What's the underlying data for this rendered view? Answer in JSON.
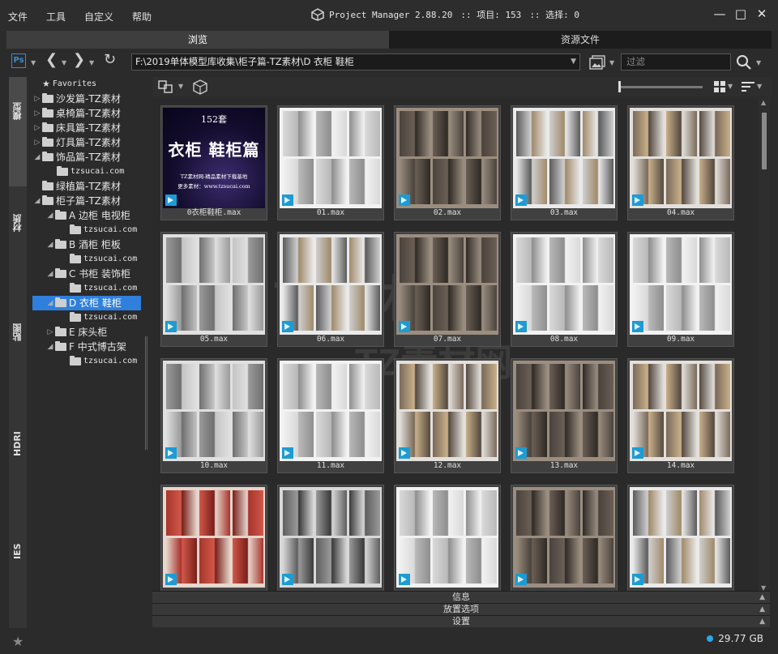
{
  "menu": {
    "file": "文件",
    "tools": "工具",
    "customize": "自定义",
    "help": "帮助"
  },
  "title": {
    "app": "Project Manager 2.88.20",
    "project": ":: 项目: 153",
    "selection": ":: 选择: 0"
  },
  "tabs": {
    "browse": "浏览",
    "assets": "资源文件"
  },
  "toolbar": {
    "path": "F:\\2019单体模型库收集\\柜子篇-TZ素材\\D 衣柜 鞋柜",
    "filter_placeholder": "过滤"
  },
  "rail": {
    "models": "模型",
    "materials": "材质",
    "maps": "贴图",
    "hdri": "HDRI",
    "ies": "IES"
  },
  "tree": {
    "favorites": "Favorites",
    "sofa": "沙发篇-TZ素材",
    "table_chair": "桌椅篇-TZ素材",
    "bed": "床具篇-TZ素材",
    "lamp": "灯具篇-TZ素材",
    "deco": "饰品篇-TZ素材",
    "deco_sub": "tzsucai.com",
    "plant": "绿植篇-TZ素材",
    "cabinet": "柜子篇-TZ素材",
    "a": "A 边柜 电视柜",
    "a_sub": "tzsucai.com",
    "b": "B 酒柜 柜板",
    "b_sub": "tzsucai.com",
    "c": "C 书柜 装饰柜",
    "c_sub": "tzsucai.com",
    "d": "D 衣柜 鞋柜",
    "d_sub": "tzsucai.com",
    "e": "E 床头柜",
    "f": "F 中式博古架",
    "f_sub": "tzsucai.com"
  },
  "cover": {
    "count": "152套",
    "title": "衣柜 鞋柜篇",
    "line1": "TZ素材网-精品素材下载基地",
    "line2": "更多素材：www.tzsucai.com"
  },
  "files": [
    {
      "name": "0衣柜鞋柜.max",
      "style": "cover"
    },
    {
      "name": "01.max",
      "style": "white"
    },
    {
      "name": "02.max",
      "style": "dark"
    },
    {
      "name": "03.max",
      "style": "mixed"
    },
    {
      "name": "04.max",
      "style": "wood"
    },
    {
      "name": "05.max",
      "style": "grey"
    },
    {
      "name": "06.max",
      "style": "mixed"
    },
    {
      "name": "07.max",
      "style": "dark"
    },
    {
      "name": "08.max",
      "style": "white"
    },
    {
      "name": "09.max",
      "style": "white"
    },
    {
      "name": "10.max",
      "style": "grey"
    },
    {
      "name": "11.max",
      "style": "white"
    },
    {
      "name": "12.max",
      "style": "wood"
    },
    {
      "name": "13.max",
      "style": "dark"
    },
    {
      "name": "14.max",
      "style": "wood"
    },
    {
      "name": "",
      "style": "red"
    },
    {
      "name": "",
      "style": "grid"
    },
    {
      "name": "",
      "style": "white"
    },
    {
      "name": "",
      "style": "dark"
    },
    {
      "name": "",
      "style": "mixed"
    }
  ],
  "panels": {
    "info": "信息",
    "placement": "放置选项",
    "settings": "设置"
  },
  "status": {
    "disk": "29.77 GB"
  },
  "watermark": {
    "brand": "TZ素材网",
    "domain": "TZSUCAI.COM"
  },
  "colors": {
    "accent": "#2f7fdc",
    "max_badge": "#1d9bd2",
    "ps": "#3a8bd6"
  }
}
